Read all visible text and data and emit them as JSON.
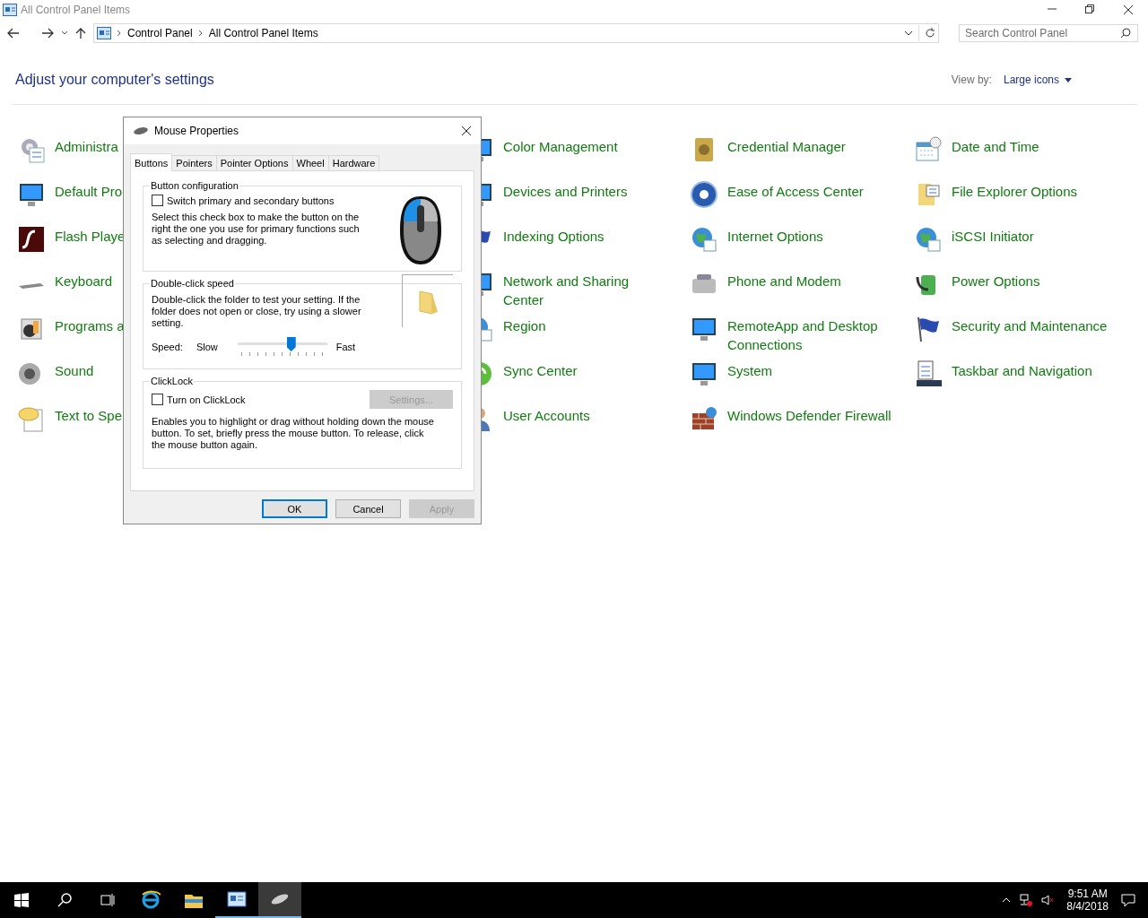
{
  "window": {
    "title": "All Control Panel Items",
    "breadcrumb": [
      "Control Panel",
      "All Control Panel Items"
    ],
    "search": {
      "placeholder": "Search Control Panel"
    },
    "heading": "Adjust your computer's settings",
    "view_by": {
      "label": "View by:",
      "value": "Large icons"
    },
    "items": [
      {
        "label": "Administra"
      },
      {
        "label": "Color Management"
      },
      {
        "label": "Credential Manager"
      },
      {
        "label": "Date and Time"
      },
      {
        "label": "Default Pro"
      },
      {
        "label": "Devices and Printers"
      },
      {
        "label": "Ease of Access Center"
      },
      {
        "label": "File Explorer Options"
      },
      {
        "label": "Flash Playe"
      },
      {
        "label": "Indexing Options"
      },
      {
        "label": "Internet Options"
      },
      {
        "label": "iSCSI Initiator"
      },
      {
        "label": "Keyboard"
      },
      {
        "label": "Network and Sharing Center"
      },
      {
        "label": "Phone and Modem"
      },
      {
        "label": "Power Options"
      },
      {
        "label": "Programs a"
      },
      {
        "label": "Region"
      },
      {
        "label": "RemoteApp and Desktop Connections"
      },
      {
        "label": "Security and Maintenance"
      },
      {
        "label": "Sound"
      },
      {
        "label": "Sync Center"
      },
      {
        "label": "System"
      },
      {
        "label": "Taskbar and Navigation"
      },
      {
        "label": "Text to Spe"
      },
      {
        "label": "User Accounts"
      },
      {
        "label": "Windows Defender Firewall"
      }
    ]
  },
  "dialog": {
    "title": "Mouse Properties",
    "tabs": [
      {
        "label": "Buttons",
        "selected": true
      },
      {
        "label": "Pointers",
        "selected": false
      },
      {
        "label": "Pointer Options",
        "selected": false
      },
      {
        "label": "Wheel",
        "selected": false
      },
      {
        "label": "Hardware",
        "selected": false
      }
    ],
    "button_configuration": {
      "title": "Button configuration",
      "checkbox": {
        "label": "Switch primary and secondary buttons",
        "checked": false
      },
      "description": "Select this check box to make the button on the right the one you use for primary functions such as selecting and dragging."
    },
    "double_click_speed": {
      "title": "Double-click speed",
      "description": "Double-click the folder to test your setting. If the folder does not open or close, try using a slower setting.",
      "speed_label": "Speed:",
      "slow_label": "Slow",
      "fast_label": "Fast",
      "level": 0.6
    },
    "clicklock": {
      "title": "ClickLock",
      "checkbox": {
        "label": "Turn on ClickLock",
        "checked": false
      },
      "settings_button": {
        "label": "Settings...",
        "disabled": true
      },
      "description": "Enables you to highlight or drag without holding down the mouse button. To set, briefly press the mouse button. To release, click the mouse button again."
    },
    "buttons": [
      {
        "label": "OK",
        "default": true,
        "disabled": false
      },
      {
        "label": "Cancel",
        "default": false,
        "disabled": false
      },
      {
        "label": "Apply",
        "default": false,
        "disabled": true
      }
    ]
  },
  "taskbar": {
    "apps": [
      {
        "kind": "browser",
        "running": false,
        "selected": false
      },
      {
        "kind": "folder",
        "running": false,
        "selected": false
      },
      {
        "kind": "control-panel",
        "running": true,
        "selected": false
      },
      {
        "kind": "mouse",
        "running": true,
        "selected": true
      }
    ],
    "clock": {
      "time": "9:51 AM",
      "date": "8/4/2018"
    }
  }
}
